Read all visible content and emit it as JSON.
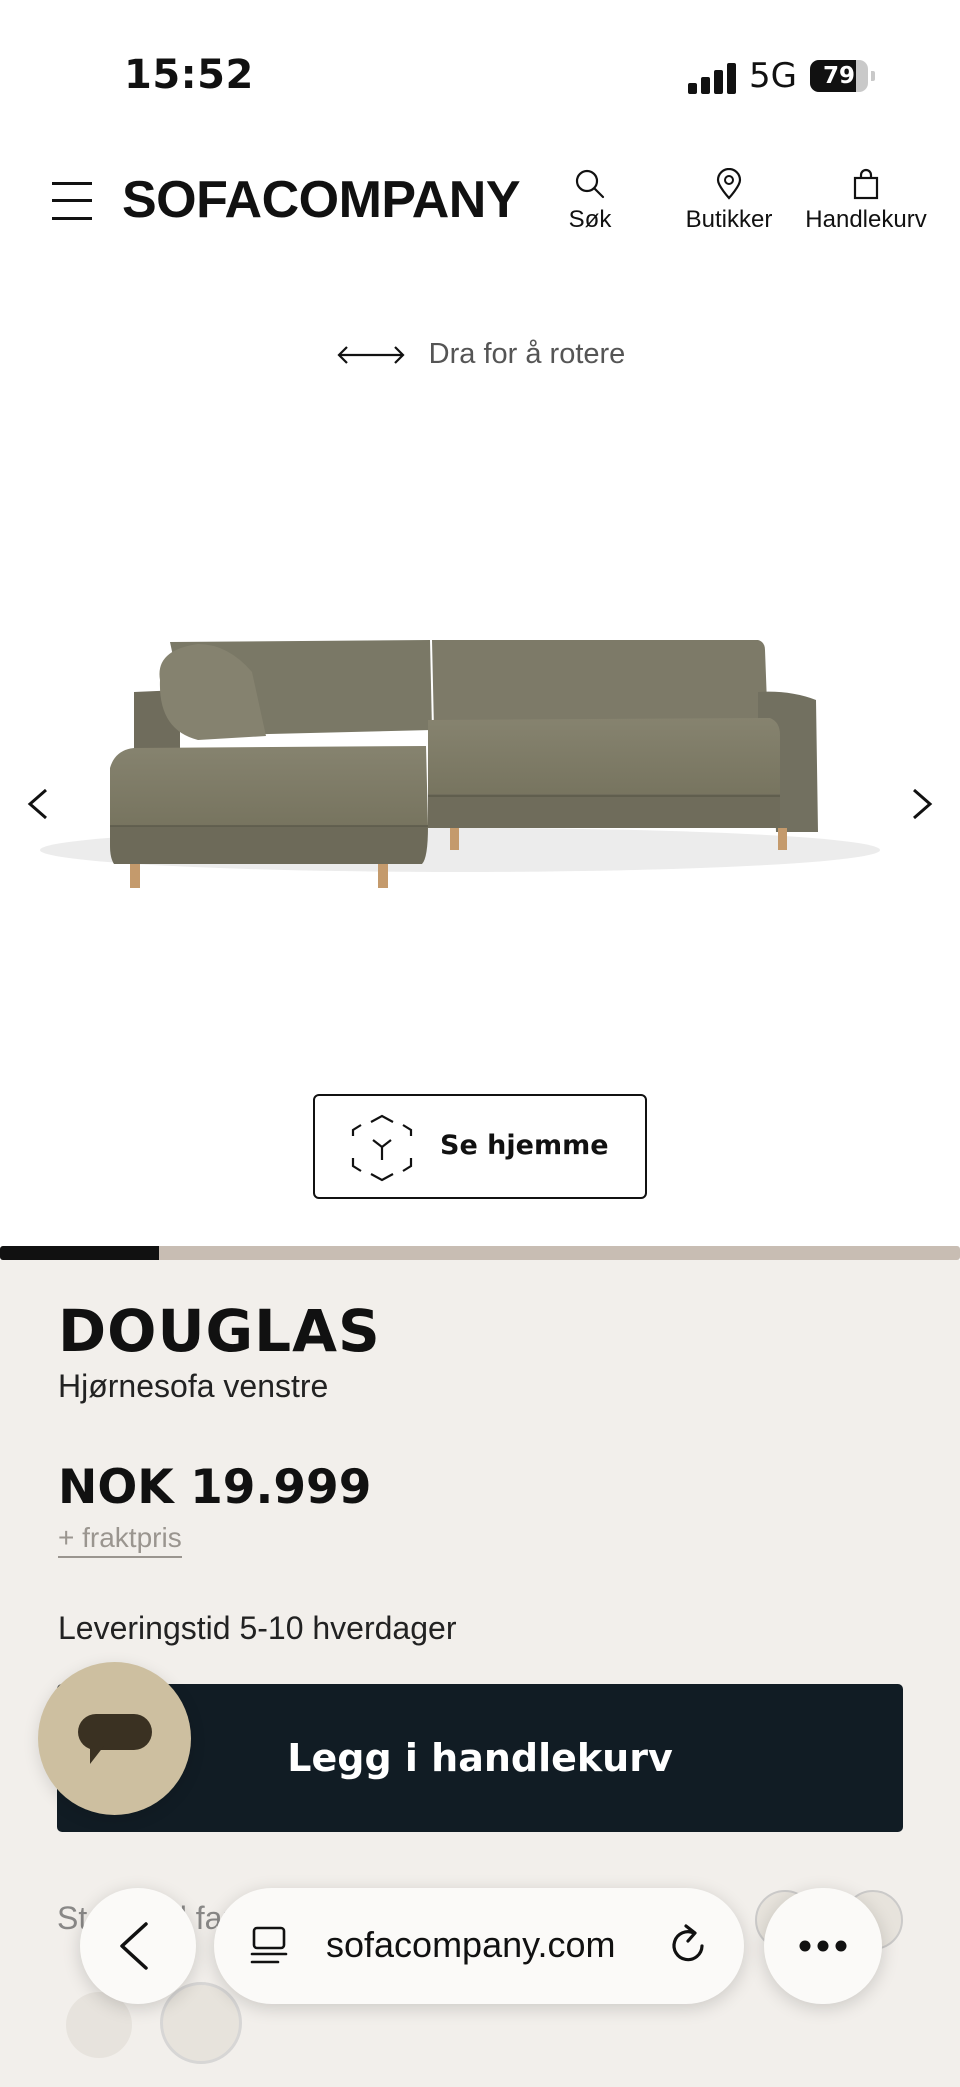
{
  "status_bar": {
    "time": "15:52",
    "network": "5G",
    "battery_percent": 79
  },
  "header": {
    "logo": "SOFACOMPANY",
    "nav": {
      "search": "Søk",
      "stores": "Butikker",
      "cart": "Handlekurv"
    },
    "icons": {
      "menu": "hamburger-icon",
      "search": "search-icon",
      "stores": "location-pin-icon",
      "cart": "shopping-bag-icon"
    }
  },
  "viewer": {
    "rotate_hint": "Dra for å rotere",
    "see_home": "Se hjemme",
    "gallery_progress": 0.166,
    "colors": {
      "fabric": "#7b7868",
      "legs": "#c49a6c"
    }
  },
  "product": {
    "name": "DOUGLAS",
    "subtitle": "Hjørnesofa venstre",
    "price": "NOK 19.999",
    "shipping_note": "+ fraktpris",
    "delivery": "Leveringstid 5-10 hverdager",
    "add_to_cart": "Legg i handlekurv",
    "fabric_label_partial": "Standard farger"
  },
  "browser": {
    "url": "sofacompany.com"
  },
  "colors": {
    "panel_bg": "#f2efeb",
    "cart_button": "#111c24",
    "chat_button": "#cdbfa0",
    "progress_track": "#c8bdb3"
  }
}
